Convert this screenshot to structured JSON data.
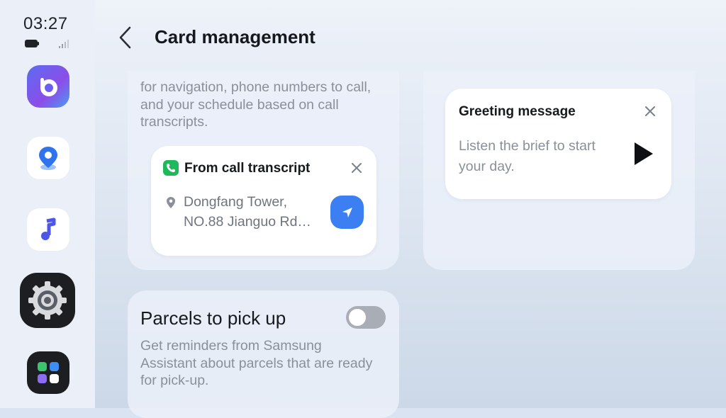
{
  "status": {
    "time": "03:27"
  },
  "header": {
    "title": "Card management"
  },
  "dock": {
    "apps": [
      {
        "name": "assistant",
        "icon": "bixby-icon"
      },
      {
        "name": "maps",
        "icon": "map-pin-icon"
      },
      {
        "name": "music",
        "icon": "music-note-icon"
      },
      {
        "name": "settings",
        "icon": "gear-icon"
      },
      {
        "name": "apps",
        "icon": "app-grid-icon"
      }
    ]
  },
  "location_card_panel": {
    "description": "for navigation, phone numbers to call, and your schedule based on call transcripts.",
    "card": {
      "title": "From call transcript",
      "address_line1": "Dongfang Tower,",
      "address_line2": "NO.88 Jianguo Rd…"
    }
  },
  "greeting_panel": {
    "card": {
      "title": "Greeting message",
      "body": "Listen the brief to start your day."
    }
  },
  "parcels_panel": {
    "title": "Parcels to pick up",
    "toggle_on": false,
    "description": "Get reminders from Samsung Assistant about parcels that are ready for pick-up."
  },
  "colors": {
    "accent_blue": "#3b7ff3",
    "call_green": "#1fb85a",
    "toggle_off": "#a9aeb6"
  }
}
